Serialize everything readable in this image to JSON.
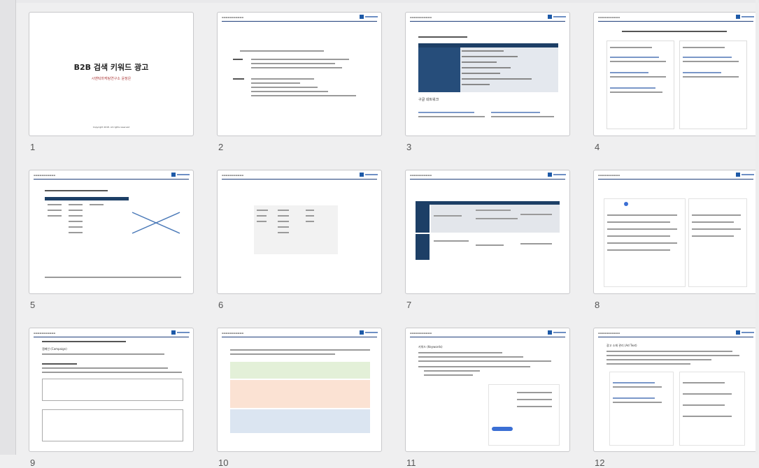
{
  "slides": [
    {
      "number": "1",
      "title": "B2B 검색 키워드 광고",
      "subtitle": "시맨틱마케팅연구소 윤정은",
      "footer": "Copyright 2018. All rights reserved"
    },
    {
      "number": "2"
    },
    {
      "number": "3",
      "heading": "구글 네트워크"
    },
    {
      "number": "4"
    },
    {
      "number": "5"
    },
    {
      "number": "6"
    },
    {
      "number": "7"
    },
    {
      "number": "8"
    },
    {
      "number": "9",
      "heading": "캠페인 (Campaign)"
    },
    {
      "number": "10"
    },
    {
      "number": "11",
      "heading": "키워드 (Keywords)"
    },
    {
      "number": "12",
      "heading": "광고 소재 관리 (Ad Text)"
    }
  ],
  "colors": {
    "accent": "#1e5aa8",
    "table_header": "#1d3f66",
    "green": "#e3f0d8",
    "orange": "#fbe2d3",
    "blue": "#dbe5f1"
  }
}
